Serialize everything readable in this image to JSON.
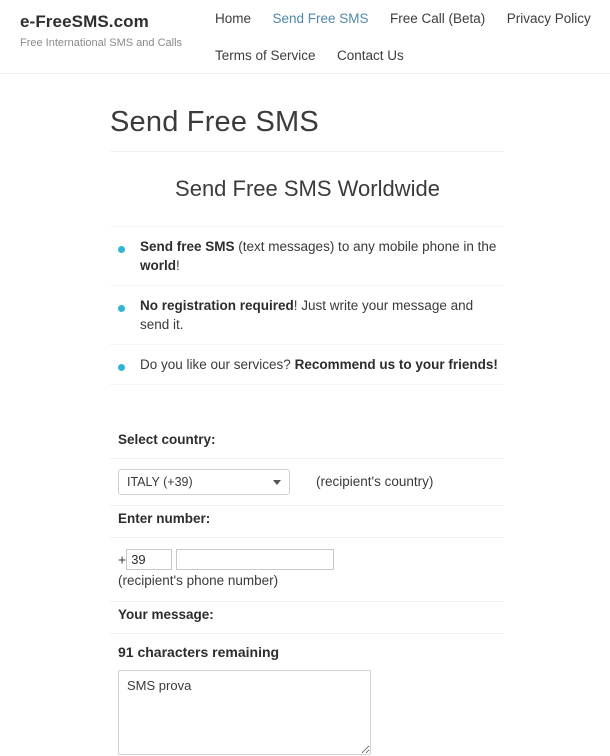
{
  "header": {
    "brand_name": "e-FreeSMS.com",
    "brand_tagline": "Free International SMS and Calls",
    "nav_rows": [
      [
        {
          "label": "Home",
          "active": false
        },
        {
          "label": "Send Free SMS",
          "active": true
        },
        {
          "label": "Free Call (Beta)",
          "active": false
        },
        {
          "label": "Privacy Policy",
          "active": false
        }
      ],
      [
        {
          "label": "Terms of Service",
          "active": false
        },
        {
          "label": "Contact Us",
          "active": false
        }
      ]
    ],
    "active_link_color": "#5189a9"
  },
  "main": {
    "page_title": "Send Free SMS",
    "section_title": "Send Free SMS Worldwide",
    "bullet_color": "#2fb6d3",
    "features": [
      {
        "parts": [
          {
            "text": "Send free SMS",
            "bold": true
          },
          {
            "text": " (text messages) to any mobile phone in the ",
            "bold": false
          },
          {
            "text": "world",
            "bold": true
          },
          {
            "text": "!",
            "bold": false
          }
        ]
      },
      {
        "parts": [
          {
            "text": "No registration required",
            "bold": true
          },
          {
            "text": "! Just write your message and send it.",
            "bold": false
          }
        ]
      },
      {
        "parts": [
          {
            "text": "Do you like our services? ",
            "bold": false
          },
          {
            "text": "Recommend us to your friends!",
            "bold": true
          }
        ]
      }
    ]
  },
  "form": {
    "country": {
      "label": "Select country:",
      "selected": "ITALY (+39)",
      "options": [
        "ITALY (+39)"
      ],
      "hint": "(recipient's country)"
    },
    "number": {
      "label": "Enter number:",
      "plus": "+",
      "prefix_value": "39",
      "number_value": "",
      "number_placeholder": "",
      "hint": "(recipient's phone number)"
    },
    "message": {
      "label": "Your message:",
      "chars_remaining": "91 characters remaining",
      "value": "SMS prova",
      "placeholder": ""
    }
  }
}
